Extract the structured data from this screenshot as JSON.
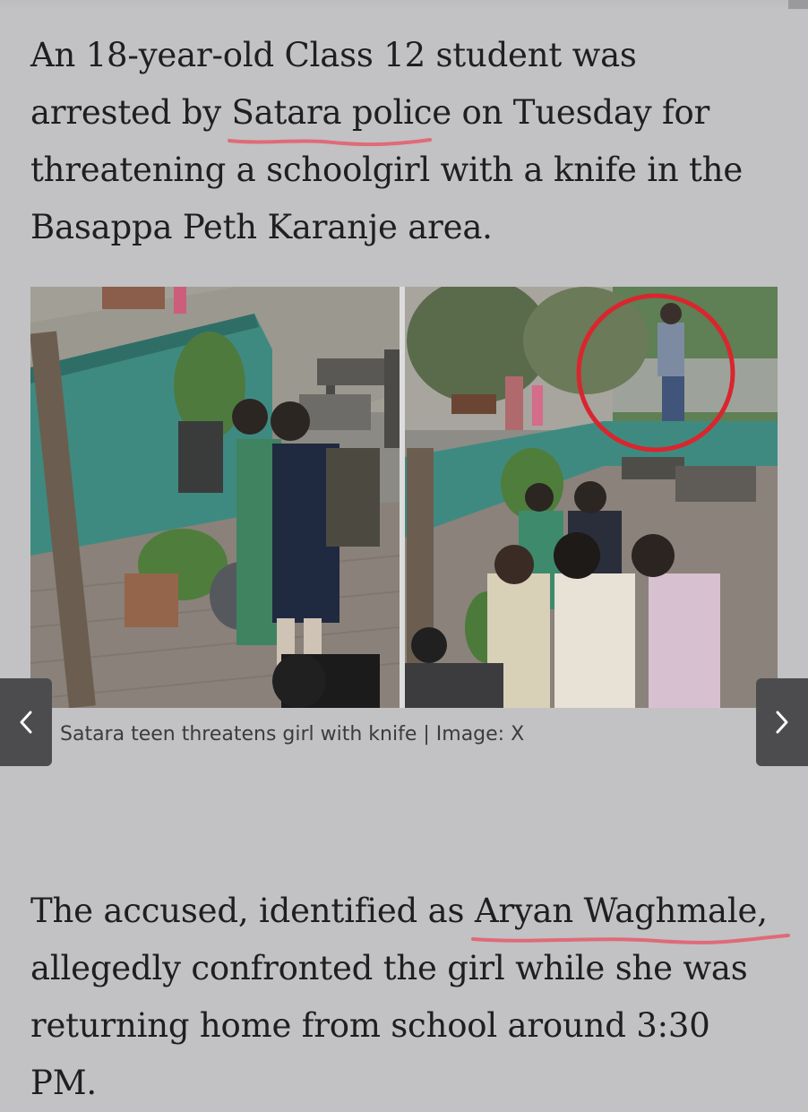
{
  "article": {
    "paragraph_1": {
      "before_link": "An 18-year-old Class 12 student was arrested by ",
      "link_text": "Satara police",
      "after_link": " on Tuesday for threatening a schoolgirl with a knife in the Basappa Peth Karanje area."
    },
    "image": {
      "alt": "Satara teen threatens girl with knife",
      "caption": "Satara teen threatens girl with knife | Image: X"
    },
    "paragraph_2": {
      "before_link": "The accused, identified as ",
      "link_text": "Aryan Waghmale",
      "after_link": ", allegedly confronted the girl while she was returning home from school around 3:30 PM."
    }
  },
  "gallery": {
    "prev_icon": "chevron-left-icon",
    "next_icon": "chevron-right-icon"
  },
  "colors": {
    "background": "#c2c1c3",
    "text": "#1f1f1f",
    "link_underline": "#e06a78",
    "highlight_circle": "#d9262e",
    "nav_button": "#4c4c4e"
  }
}
